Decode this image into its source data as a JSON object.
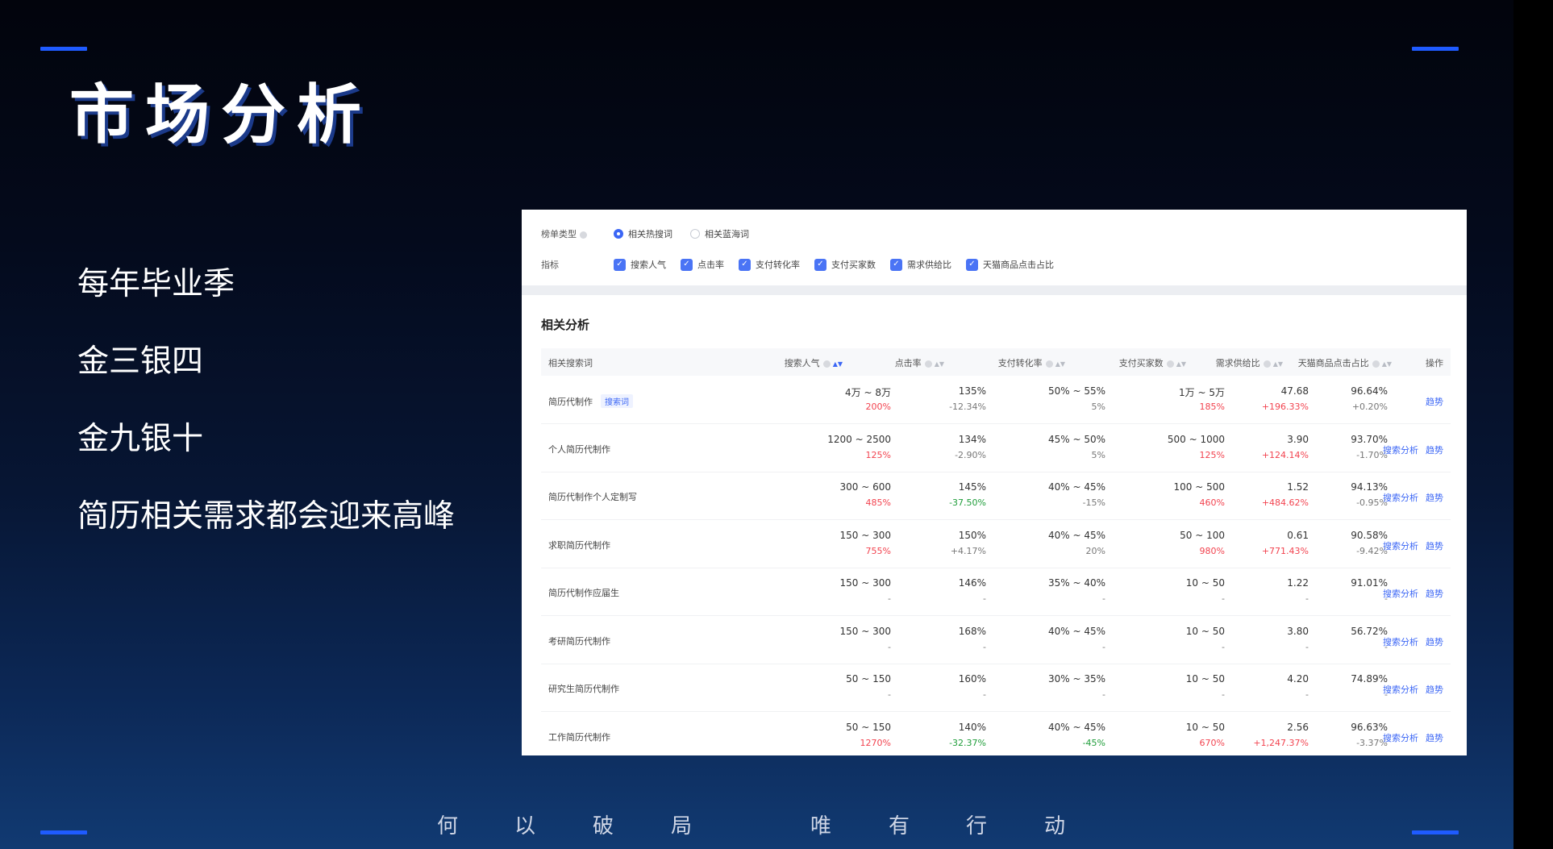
{
  "slide": {
    "title": "市场分析",
    "bullets": [
      "每年毕业季",
      "金三银四",
      "金九银十",
      "简历相关需求都会迎来高峰"
    ],
    "footer": {
      "left": [
        "何",
        "以",
        "破",
        "局"
      ],
      "right": [
        "唯",
        "有",
        "行",
        "动"
      ]
    }
  },
  "colors": {
    "accent": "#1f5bff",
    "link": "#3b66f5",
    "up": "#f2434f",
    "down": "#1f9d3a"
  },
  "filters": {
    "list_type_label": "榜单类型",
    "list_types": [
      {
        "label": "相关热搜词",
        "selected": true
      },
      {
        "label": "相关蓝海词",
        "selected": false
      }
    ],
    "metrics_label": "指标",
    "metrics": [
      "搜索人气",
      "点击率",
      "支付转化率",
      "支付买家数",
      "需求供给比",
      "天猫商品点击占比"
    ]
  },
  "section_title": "相关分析",
  "table": {
    "columns": [
      "相关搜索词",
      "搜索人气",
      "点击率",
      "支付转化率",
      "支付买家数",
      "需求供给比",
      "天猫商品点击占比",
      "操作"
    ],
    "search_tag": "搜索词",
    "action_search_analysis": "搜索分析",
    "action_trend": "趋势",
    "rows": [
      {
        "keyword": "简历代制作",
        "tag": true,
        "popularity": "4万 ~ 8万",
        "popularity_change": "200%",
        "popularity_dir": "up",
        "ctr": "135%",
        "ctr_change": "-12.34%",
        "ctr_dir": "flat",
        "conv": "50% ~ 55%",
        "conv_change": "5%",
        "conv_dir": "flat",
        "buyers": "1万 ~ 5万",
        "buyers_change": "185%",
        "buyers_dir": "up",
        "ratio": "47.68",
        "ratio_change": "+196.33%",
        "ratio_dir": "up",
        "tmall": "96.64%",
        "tmall_change": "+0.20%",
        "tmall_dir": "flat",
        "has_search": false
      },
      {
        "keyword": "个人简历代制作",
        "tag": false,
        "popularity": "1200 ~ 2500",
        "popularity_change": "125%",
        "popularity_dir": "up",
        "ctr": "134%",
        "ctr_change": "-2.90%",
        "ctr_dir": "flat",
        "conv": "45% ~ 50%",
        "conv_change": "5%",
        "conv_dir": "flat",
        "buyers": "500 ~ 1000",
        "buyers_change": "125%",
        "buyers_dir": "up",
        "ratio": "3.90",
        "ratio_change": "+124.14%",
        "ratio_dir": "up",
        "tmall": "93.70%",
        "tmall_change": "-1.70%",
        "tmall_dir": "flat",
        "has_search": true
      },
      {
        "keyword": "简历代制作个人定制写",
        "tag": false,
        "popularity": "300 ~ 600",
        "popularity_change": "485%",
        "popularity_dir": "up",
        "ctr": "145%",
        "ctr_change": "-37.50%",
        "ctr_dir": "down",
        "conv": "40% ~ 45%",
        "conv_change": "-15%",
        "conv_dir": "flat",
        "buyers": "100 ~ 500",
        "buyers_change": "460%",
        "buyers_dir": "up",
        "ratio": "1.52",
        "ratio_change": "+484.62%",
        "ratio_dir": "up",
        "tmall": "94.13%",
        "tmall_change": "-0.95%",
        "tmall_dir": "flat",
        "has_search": true
      },
      {
        "keyword": "求职简历代制作",
        "tag": false,
        "popularity": "150 ~ 300",
        "popularity_change": "755%",
        "popularity_dir": "up",
        "ctr": "150%",
        "ctr_change": "+4.17%",
        "ctr_dir": "flat",
        "conv": "40% ~ 45%",
        "conv_change": "20%",
        "conv_dir": "flat",
        "buyers": "50 ~ 100",
        "buyers_change": "980%",
        "buyers_dir": "up",
        "ratio": "0.61",
        "ratio_change": "+771.43%",
        "ratio_dir": "up",
        "tmall": "90.58%",
        "tmall_change": "-9.42%",
        "tmall_dir": "flat",
        "has_search": true
      },
      {
        "keyword": "简历代制作应届生",
        "tag": false,
        "popularity": "150 ~ 300",
        "popularity_change": "-",
        "popularity_dir": "flat",
        "ctr": "146%",
        "ctr_change": "-",
        "ctr_dir": "flat",
        "conv": "35% ~ 40%",
        "conv_change": "-",
        "conv_dir": "flat",
        "buyers": "10 ~ 50",
        "buyers_change": "-",
        "buyers_dir": "flat",
        "ratio": "1.22",
        "ratio_change": "-",
        "ratio_dir": "flat",
        "tmall": "91.01%",
        "tmall_change": "-",
        "tmall_dir": "flat",
        "has_search": true
      },
      {
        "keyword": "考研简历代制作",
        "tag": false,
        "popularity": "150 ~ 300",
        "popularity_change": "-",
        "popularity_dir": "flat",
        "ctr": "168%",
        "ctr_change": "-",
        "ctr_dir": "flat",
        "conv": "40% ~ 45%",
        "conv_change": "-",
        "conv_dir": "flat",
        "buyers": "10 ~ 50",
        "buyers_change": "-",
        "buyers_dir": "flat",
        "ratio": "3.80",
        "ratio_change": "-",
        "ratio_dir": "flat",
        "tmall": "56.72%",
        "tmall_change": "-",
        "tmall_dir": "flat",
        "has_search": true
      },
      {
        "keyword": "研究生简历代制作",
        "tag": false,
        "popularity": "50 ~ 150",
        "popularity_change": "-",
        "popularity_dir": "flat",
        "ctr": "160%",
        "ctr_change": "-",
        "ctr_dir": "flat",
        "conv": "30% ~ 35%",
        "conv_change": "-",
        "conv_dir": "flat",
        "buyers": "10 ~ 50",
        "buyers_change": "-",
        "buyers_dir": "flat",
        "ratio": "4.20",
        "ratio_change": "-",
        "ratio_dir": "flat",
        "tmall": "74.89%",
        "tmall_change": "-",
        "tmall_dir": "flat",
        "has_search": true
      },
      {
        "keyword": "工作简历代制作",
        "tag": false,
        "popularity": "50 ~ 150",
        "popularity_change": "1270%",
        "popularity_dir": "up",
        "ctr": "140%",
        "ctr_change": "-32.37%",
        "ctr_dir": "down",
        "conv": "40% ~ 45%",
        "conv_change": "-45%",
        "conv_dir": "down",
        "buyers": "10 ~ 50",
        "buyers_change": "670%",
        "buyers_dir": "up",
        "ratio": "2.56",
        "ratio_change": "+1,247.37%",
        "ratio_dir": "up",
        "tmall": "96.63%",
        "tmall_change": "-3.37%",
        "tmall_dir": "flat",
        "has_search": true
      }
    ]
  }
}
